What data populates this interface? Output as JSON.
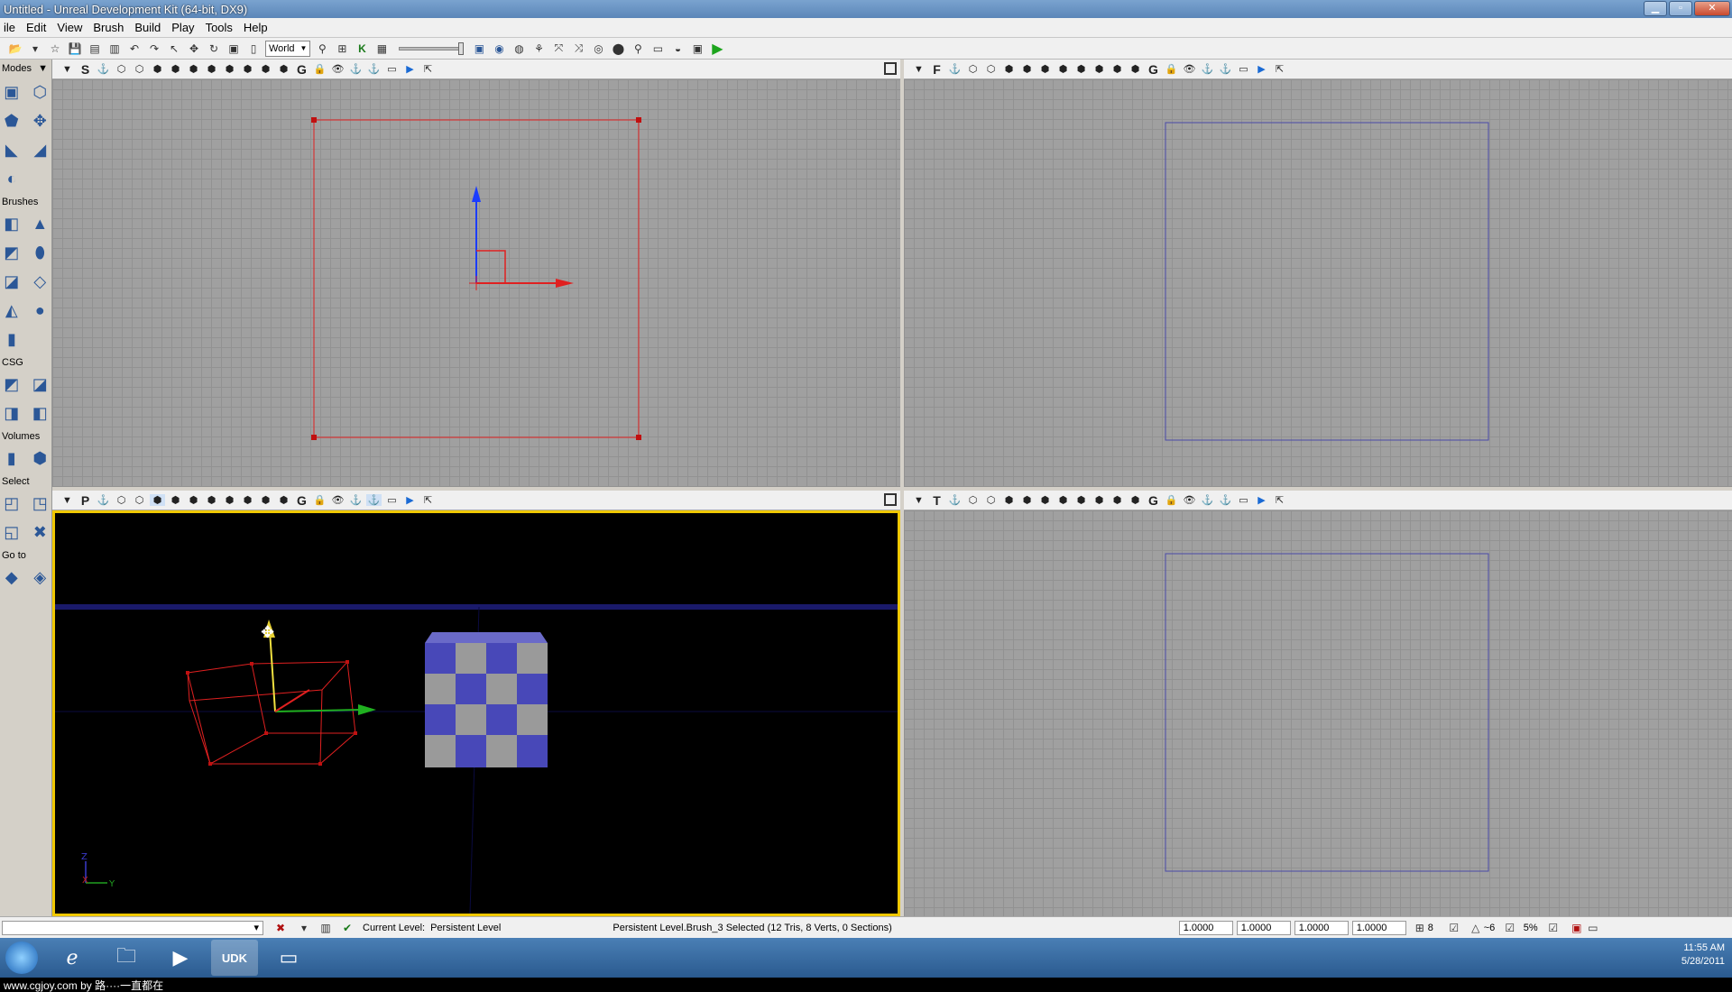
{
  "window": {
    "title": "Untitled - Unreal Development Kit (64-bit, DX9)"
  },
  "menu": [
    "ile",
    "Edit",
    "View",
    "Brush",
    "Build",
    "Play",
    "Tools",
    "Help"
  ],
  "main_toolbar": {
    "coord_system": "World"
  },
  "modes_panel": {
    "title": "Modes",
    "sections": {
      "brushes": "Brushes",
      "csg": "CSG",
      "volumes": "Volumes",
      "select": "Select",
      "goto": "Go to"
    }
  },
  "viewports": {
    "top_left": {
      "mode": "S"
    },
    "top_right": {
      "mode": "F"
    },
    "bottom_left": {
      "mode": "P",
      "axis_z": "Z",
      "axis_x": "X",
      "axis_y": "Y"
    },
    "bottom_right": {
      "mode": "T"
    },
    "toolbar_letter_g": "G"
  },
  "status_bar": {
    "current_level_label": "Current Level:",
    "current_level_value": "Persistent Level",
    "selection_info": "Persistent Level.Brush_3 Selected (12 Tris, 8 Verts, 0 Sections)",
    "drag_values": [
      "1.0000",
      "1.0000",
      "1.0000",
      "1.0000"
    ],
    "grid_size": "8",
    "rotation_snap": "~6",
    "scale_snap": "5%"
  },
  "taskbar": {
    "apps": [
      "ie",
      "explorer",
      "media",
      "UDK",
      "folder"
    ],
    "udk_label": "UDK",
    "clock_time": "11:55 AM",
    "clock_date": "5/28/2011"
  },
  "watermark": "www.cgjoy.com by 路····一直都在",
  "colors": {
    "selection_red": "#e02020",
    "pivot_blue": "#1a3cff",
    "persp_border": "#f0c800",
    "checker_blue": "#4848b8",
    "checker_grey": "#9a9a9a"
  }
}
